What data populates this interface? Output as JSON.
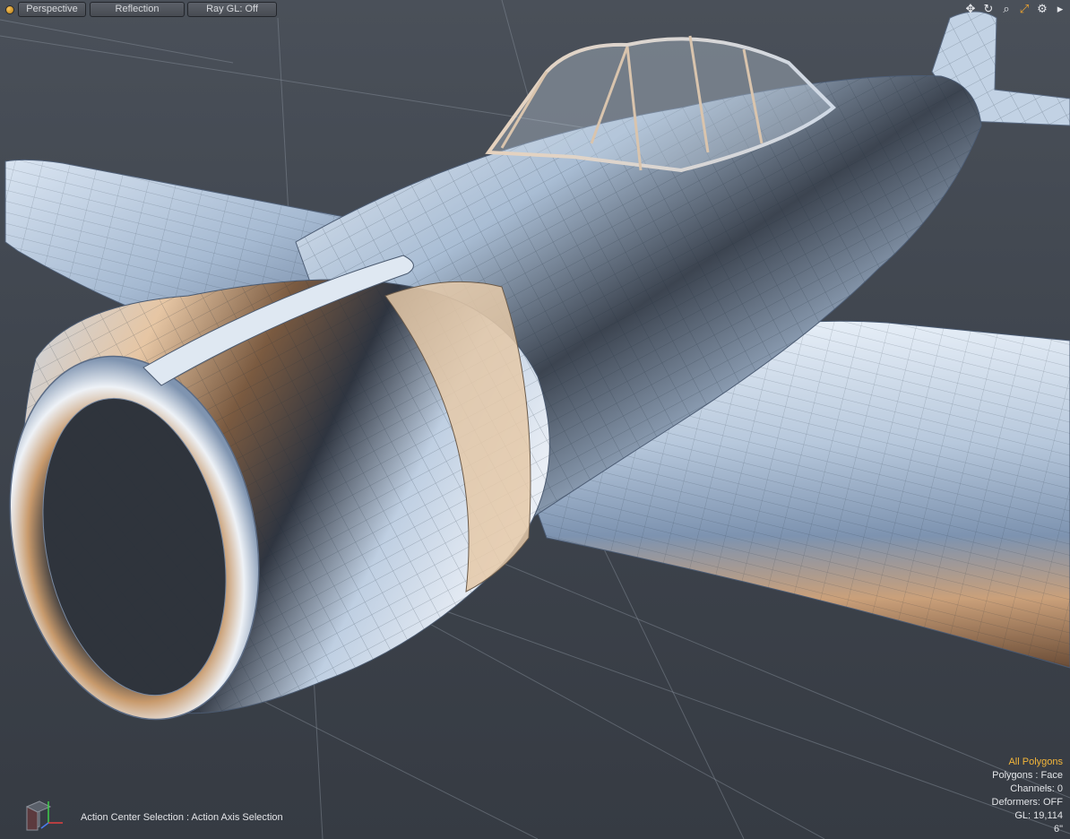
{
  "viewport": {
    "view_label": "Perspective",
    "shading_label": "Reflection",
    "raygl_label": "Ray GL: Off"
  },
  "tools": [
    {
      "icon": "move-icon",
      "glyph": "✥"
    },
    {
      "icon": "rotate-icon",
      "glyph": "↻"
    },
    {
      "icon": "zoom-icon",
      "glyph": "⌕"
    },
    {
      "icon": "maximize-icon",
      "glyph": "⤢"
    },
    {
      "icon": "gear-icon",
      "glyph": "⚙"
    },
    {
      "icon": "arrow-right-icon",
      "glyph": "▸"
    }
  ],
  "status": {
    "action_center": "Action Center Selection : Action Axis Selection"
  },
  "stats": {
    "selection_mode": "All Polygons",
    "polygons": "Polygons : Face",
    "channels": "Channels: 0",
    "deformers": "Deformers: OFF",
    "gl": "GL: 19,114",
    "grid_size": "6\""
  },
  "colors": {
    "viewport_bg": "#3f454e",
    "highlight": "#f3b53a",
    "model_blue": "#9bb8da",
    "model_copper": "#a8764a"
  }
}
